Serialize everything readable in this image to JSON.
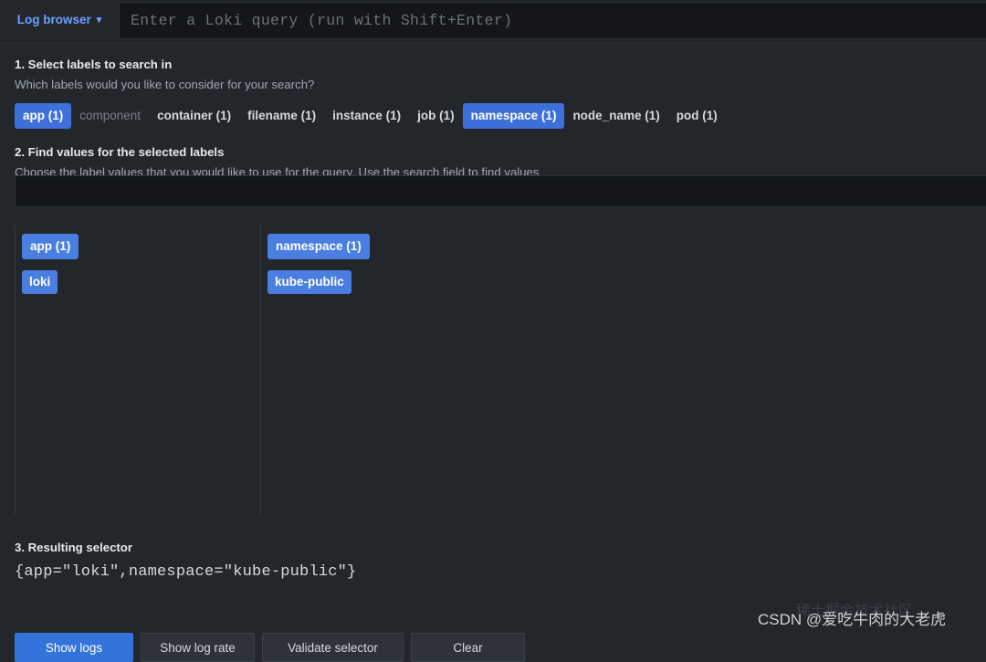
{
  "query_bar": {
    "log_browser_label": "Log browser",
    "chevron_icon": "chevron-down-icon",
    "query_placeholder": "Enter a Loki query (run with Shift+Enter)",
    "query_value": ""
  },
  "step1": {
    "title": "1. Select labels to search in",
    "description": "Which labels would you like to consider for your search?",
    "labels": [
      {
        "label": "app (1)",
        "selected": true,
        "muted": false
      },
      {
        "label": "component",
        "selected": false,
        "muted": true
      },
      {
        "label": "container (1)",
        "selected": false,
        "muted": false
      },
      {
        "label": "filename (1)",
        "selected": false,
        "muted": false
      },
      {
        "label": "instance (1)",
        "selected": false,
        "muted": false
      },
      {
        "label": "job (1)",
        "selected": false,
        "muted": false
      },
      {
        "label": "namespace (1)",
        "selected": true,
        "muted": false
      },
      {
        "label": "node_name (1)",
        "selected": false,
        "muted": false
      },
      {
        "label": "pod (1)",
        "selected": false,
        "muted": false
      }
    ]
  },
  "step2": {
    "title": "2. Find values for the selected labels",
    "description": "Choose the label values that you would like to use for the query. Use the search field to find values across selected labels.",
    "search_placeholder": "",
    "search_value": "",
    "columns": [
      {
        "header": "app (1)",
        "values": [
          "loki"
        ]
      },
      {
        "header": "namespace (1)",
        "values": [
          "kube-public"
        ]
      }
    ]
  },
  "step3": {
    "title": "3. Resulting selector",
    "selector": "{app=\"loki\",namespace=\"kube-public\"}"
  },
  "actions": [
    {
      "label": "Show logs",
      "style": "primary"
    },
    {
      "label": "Show log rate",
      "style": "secondary"
    },
    {
      "label": "Validate selector",
      "style": "secondary-wide"
    },
    {
      "label": "Clear",
      "style": "secondary"
    }
  ],
  "watermark": {
    "text": "CSDN @爱吃牛肉的大老虎",
    "ghost": "稀土掘金技术社区"
  },
  "colors": {
    "accent_blue": "#3d71d9",
    "chip_blue": "#4a7ee0",
    "link_blue": "#6e9fff",
    "panel_bg": "#23272c",
    "input_bg": "#141619",
    "border": "#2c3235",
    "divider": "#343a40",
    "text": "#d8d9da",
    "text_muted": "#9fa7b3"
  }
}
